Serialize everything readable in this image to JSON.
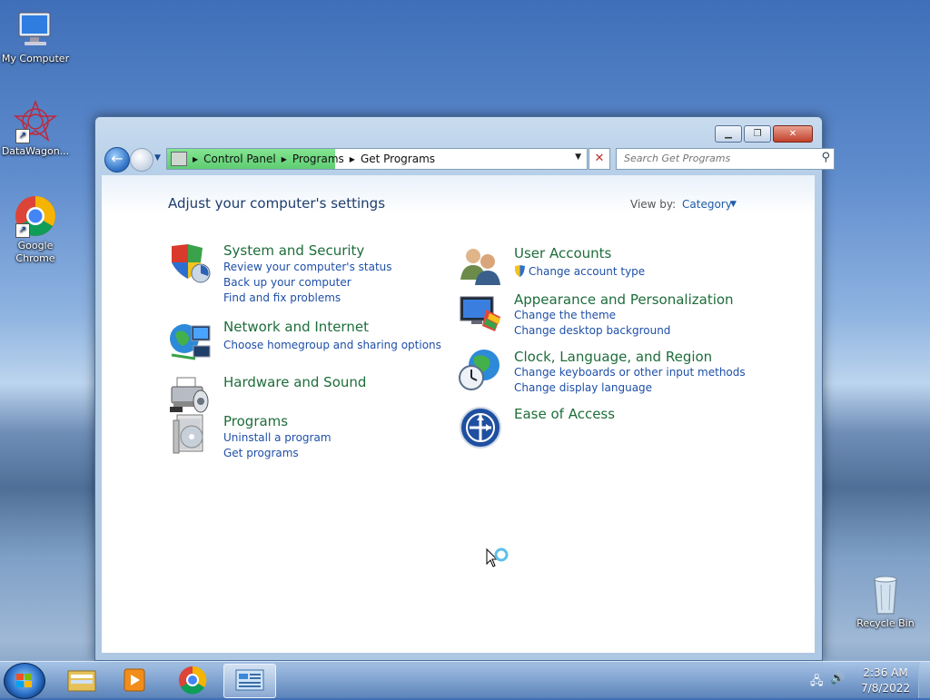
{
  "desktop": {
    "icons": [
      {
        "label": "My Computer"
      },
      {
        "label": "DataWagon..."
      },
      {
        "label": "Google Chrome"
      },
      {
        "label": "Recycle Bin"
      }
    ]
  },
  "window": {
    "breadcrumb": [
      "Control Panel",
      "Programs",
      "Get Programs"
    ],
    "search_placeholder": "Search Get Programs",
    "heading": "Adjust your computer's settings",
    "view_by_label": "View by:",
    "view_by_value": "Category",
    "categories": [
      {
        "title": "System and Security",
        "icon": "shield-icon",
        "links": [
          "Review your computer's status",
          "Back up your computer",
          "Find and fix problems"
        ]
      },
      {
        "title": "Network and Internet",
        "icon": "network-icon",
        "links": [
          "Choose homegroup and sharing options"
        ]
      },
      {
        "title": "Hardware and Sound",
        "icon": "printer-icon",
        "links": []
      },
      {
        "title": "Programs",
        "icon": "programs-icon",
        "links": [
          "Uninstall a program",
          "Get programs"
        ]
      },
      {
        "title": "User Accounts",
        "icon": "users-icon",
        "links": [
          "Change account type"
        ]
      },
      {
        "title": "Appearance and Personalization",
        "icon": "monitor-icon",
        "links": [
          "Change the theme",
          "Change desktop background"
        ]
      },
      {
        "title": "Clock, Language, and Region",
        "icon": "globe-clock-icon",
        "links": [
          "Change keyboards or other input methods",
          "Change display language"
        ]
      },
      {
        "title": "Ease of Access",
        "icon": "ease-of-access-icon",
        "links": []
      }
    ]
  },
  "taskbar": {
    "time": "2:36 AM",
    "date": "7/8/2022",
    "pinned": [
      "file-explorer-icon",
      "media-player-icon",
      "chrome-icon",
      "control-panel-icon"
    ]
  }
}
